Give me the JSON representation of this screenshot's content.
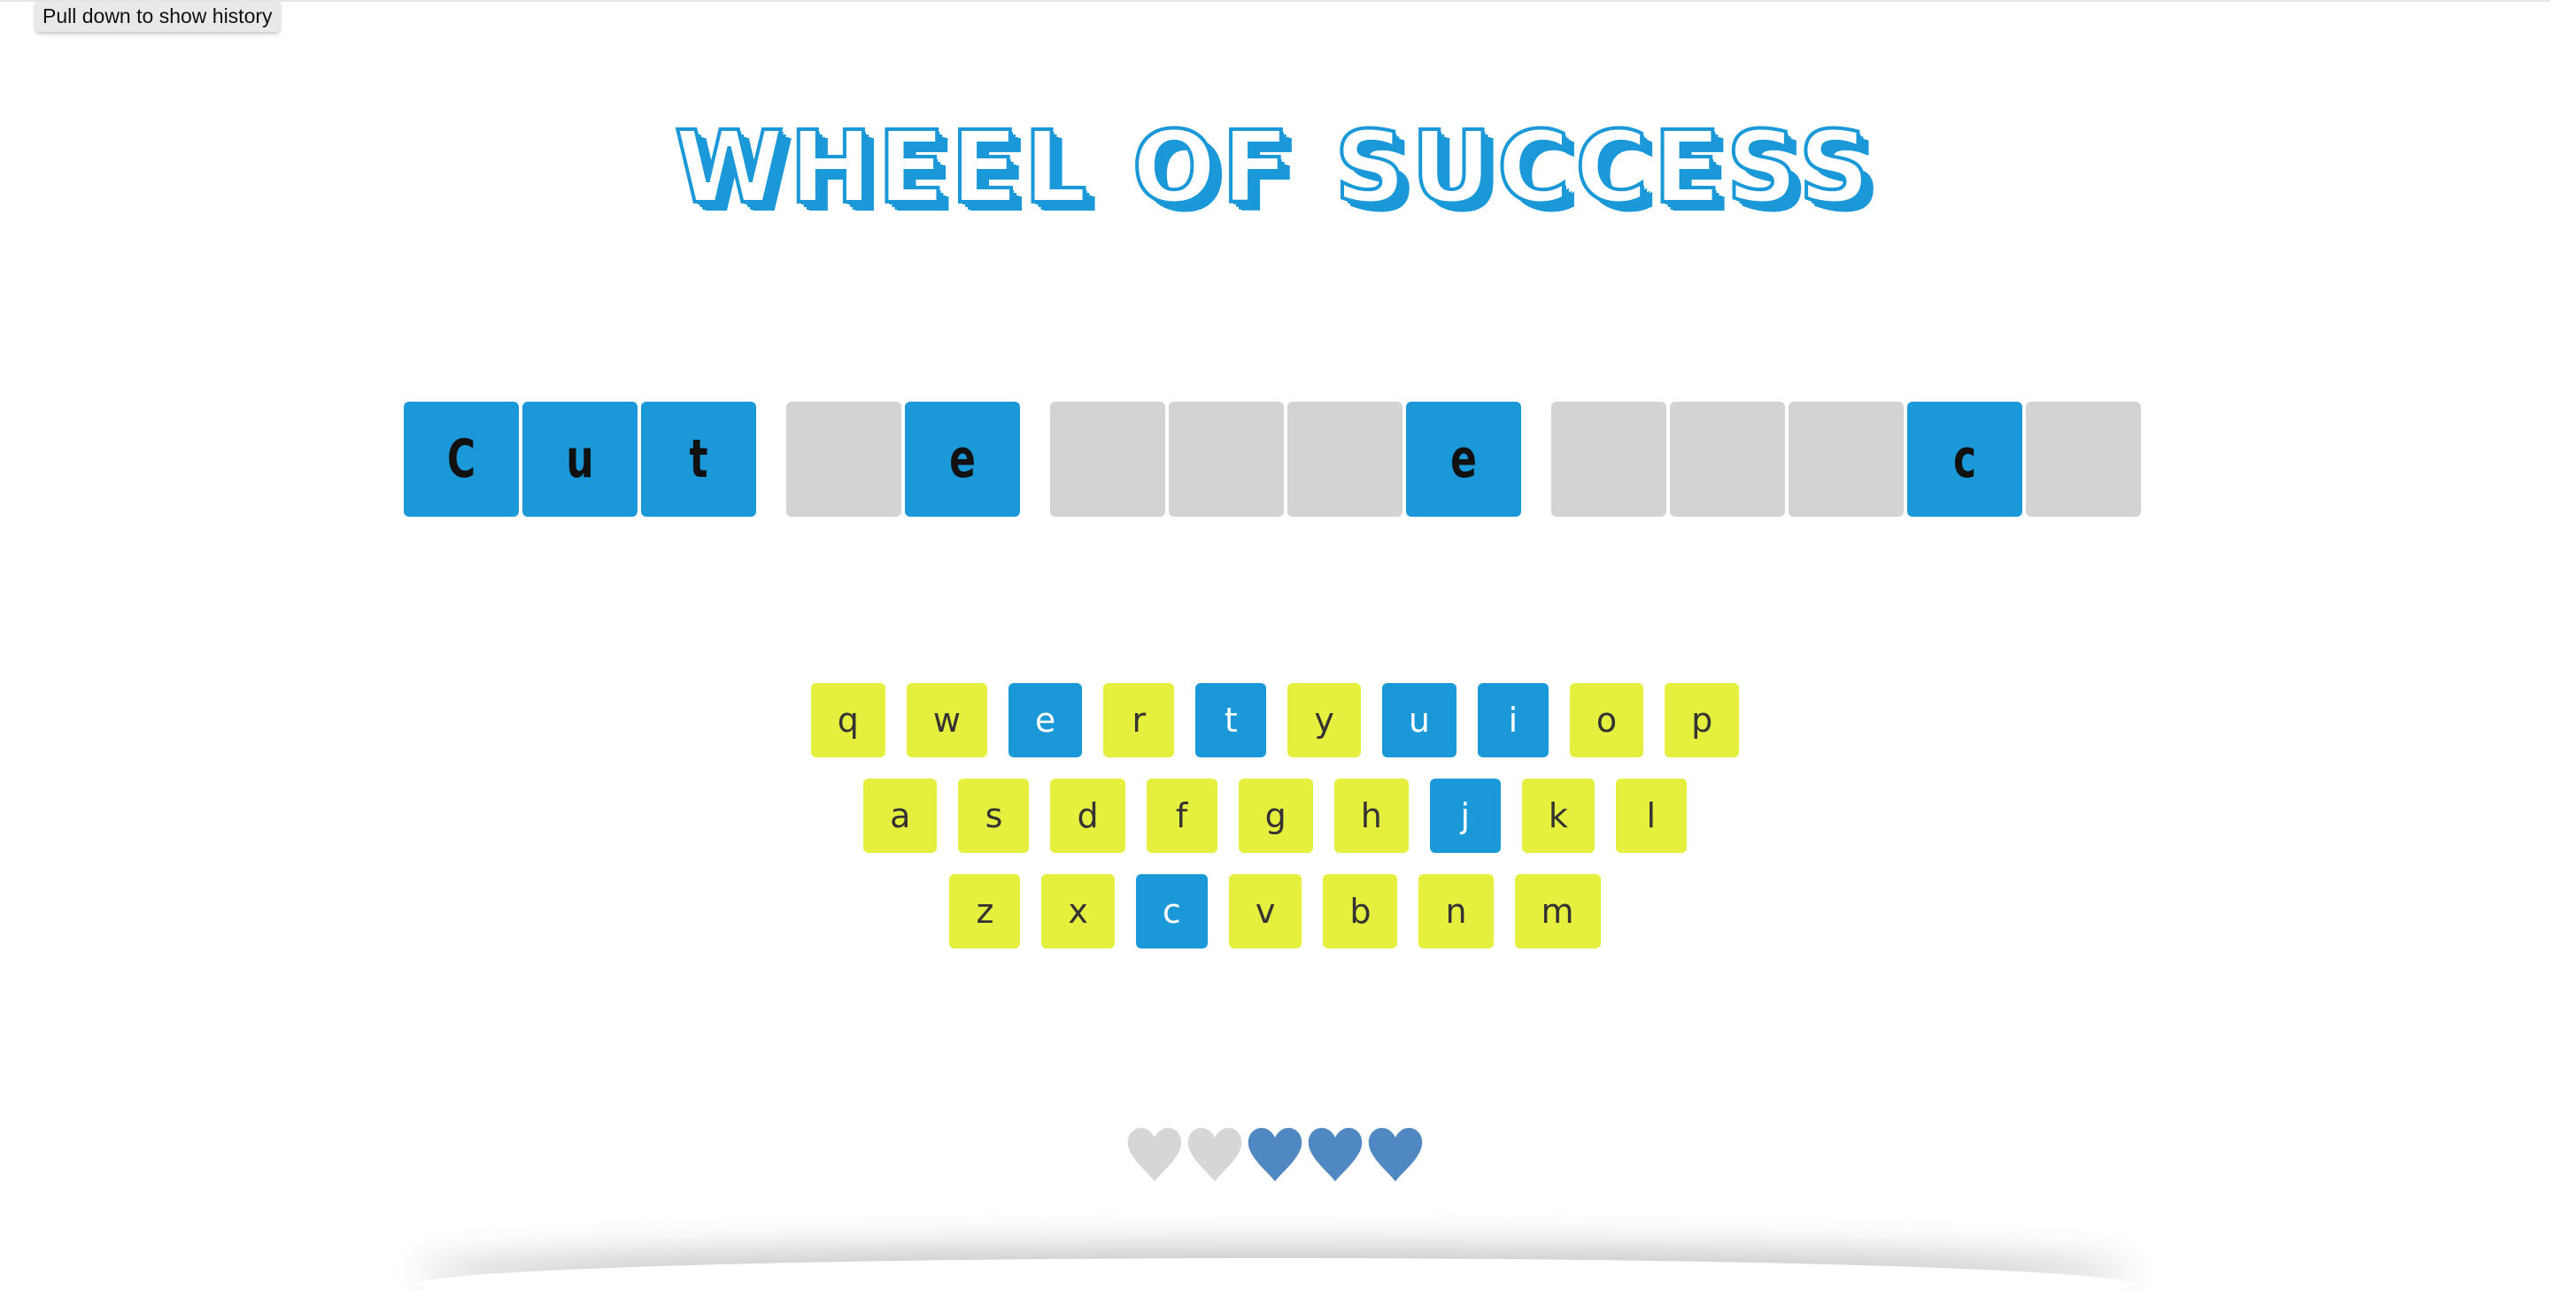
{
  "tooltip": {
    "text": "Pull down to show history"
  },
  "title": "WHEEL OF SUCCESS",
  "colors": {
    "accent": "#1a98d8",
    "key_default": "#e5ef3e",
    "tile_hidden": "#d3d3d3",
    "heart_full": "#4f88c2",
    "heart_empty": "#d6d6d6"
  },
  "puzzle": {
    "words": [
      {
        "tiles": [
          {
            "letter": "C",
            "revealed": true
          },
          {
            "letter": "u",
            "revealed": true
          },
          {
            "letter": "t",
            "revealed": true
          }
        ]
      },
      {
        "tiles": [
          {
            "letter": "",
            "revealed": false
          },
          {
            "letter": "e",
            "revealed": true
          }
        ]
      },
      {
        "tiles": [
          {
            "letter": "",
            "revealed": false
          },
          {
            "letter": "",
            "revealed": false
          },
          {
            "letter": "",
            "revealed": false
          },
          {
            "letter": "e",
            "revealed": true
          }
        ]
      },
      {
        "tiles": [
          {
            "letter": "",
            "revealed": false
          },
          {
            "letter": "",
            "revealed": false
          },
          {
            "letter": "",
            "revealed": false
          },
          {
            "letter": "c",
            "revealed": true
          },
          {
            "letter": "",
            "revealed": false
          }
        ]
      }
    ]
  },
  "keyboard": {
    "rows": [
      [
        {
          "key": "q",
          "used": false
        },
        {
          "key": "w",
          "used": false
        },
        {
          "key": "e",
          "used": true
        },
        {
          "key": "r",
          "used": false
        },
        {
          "key": "t",
          "used": true
        },
        {
          "key": "y",
          "used": false
        },
        {
          "key": "u",
          "used": true
        },
        {
          "key": "i",
          "used": true
        },
        {
          "key": "o",
          "used": false
        },
        {
          "key": "p",
          "used": false
        }
      ],
      [
        {
          "key": "a",
          "used": false
        },
        {
          "key": "s",
          "used": false
        },
        {
          "key": "d",
          "used": false
        },
        {
          "key": "f",
          "used": false
        },
        {
          "key": "g",
          "used": false
        },
        {
          "key": "h",
          "used": false
        },
        {
          "key": "j",
          "used": true
        },
        {
          "key": "k",
          "used": false
        },
        {
          "key": "l",
          "used": false
        }
      ],
      [
        {
          "key": "z",
          "used": false
        },
        {
          "key": "x",
          "used": false
        },
        {
          "key": "c",
          "used": true
        },
        {
          "key": "v",
          "used": false
        },
        {
          "key": "b",
          "used": false
        },
        {
          "key": "n",
          "used": false
        },
        {
          "key": "m",
          "used": false
        }
      ]
    ]
  },
  "lives": {
    "total": 5,
    "remaining": 3
  }
}
